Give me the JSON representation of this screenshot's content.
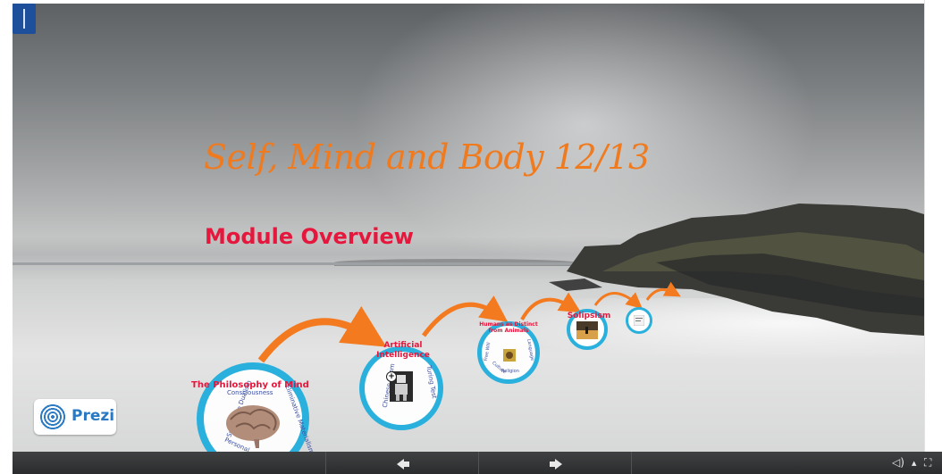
{
  "presentation": {
    "title": "Self, Mind and Body 12/13",
    "subtitle": "Module Overview"
  },
  "frames": [
    {
      "label": "The Philosophy of Mind",
      "words": [
        "Consciousness",
        "Substance Dualism",
        "Eliminative Materialism",
        "Personal..."
      ]
    },
    {
      "label": "Artificial Intelligence",
      "words": [
        "Chinese Room",
        "Turing Test"
      ]
    },
    {
      "label": "Humans as Distinct from Animals",
      "words": [
        "Free Will",
        "Language",
        "Religion",
        "Culture"
      ]
    },
    {
      "label": "Solipsism"
    },
    {
      "label": ""
    }
  ],
  "branding": {
    "logo_text": "Prezi"
  },
  "toolbar": {
    "prev_icon": "arrow-left-icon",
    "next_icon": "arrow-right-icon",
    "sound_icon": "speaker-icon",
    "fullscreen_icon": "fullscreen-icon"
  },
  "colors": {
    "title": "#f07a1e",
    "subtitle": "#e5173c",
    "frame_ring": "#2ab0dc",
    "path_arrow": "#f47a1f",
    "toolbar": "#333435"
  }
}
